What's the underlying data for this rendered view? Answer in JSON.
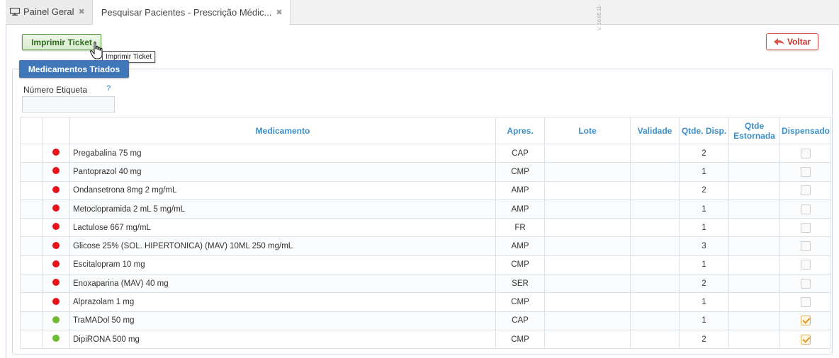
{
  "tabs": [
    {
      "label": "Painel Geral",
      "active": false
    },
    {
      "label": "Pesquisar Pacientes - Prescrição Médic...",
      "active": true
    }
  ],
  "version_text": "V. 10.85.11-",
  "print_button": {
    "label": "Imprimir Ticket",
    "tooltip": "Imprimir Ticket"
  },
  "back_button": {
    "label": "Voltar"
  },
  "panel": {
    "title": "Medicamentos Triados",
    "etiqueta_label": "Número Etiqueta",
    "etiqueta_help": "?",
    "etiqueta_value": ""
  },
  "table": {
    "columns": [
      "",
      "",
      "Medicamento",
      "Apres.",
      "Lote",
      "Validade",
      "Qtde. Disp.",
      "Qtde Estornada",
      "Dispensado"
    ],
    "status_colors": {
      "red": "#e8131a",
      "green": "#6dbb2f"
    },
    "rows": [
      {
        "status": "red",
        "medicamento": "Pregabalina 75 mg",
        "apres": "CAP",
        "lote": "",
        "validade": "",
        "qtde_disp": "2",
        "qtde_estornada": "",
        "dispensado": false
      },
      {
        "status": "red",
        "medicamento": "Pantoprazol 40 mg",
        "apres": "CMP",
        "lote": "",
        "validade": "",
        "qtde_disp": "1",
        "qtde_estornada": "",
        "dispensado": false
      },
      {
        "status": "red",
        "medicamento": "Ondansetrona 8mg 2 mg/mL",
        "apres": "AMP",
        "lote": "",
        "validade": "",
        "qtde_disp": "2",
        "qtde_estornada": "",
        "dispensado": false
      },
      {
        "status": "red",
        "medicamento": "Metoclopramida 2 mL 5 mg/mL",
        "apres": "AMP",
        "lote": "",
        "validade": "",
        "qtde_disp": "1",
        "qtde_estornada": "",
        "dispensado": false
      },
      {
        "status": "red",
        "medicamento": "Lactulose 667 mg/mL",
        "apres": "FR",
        "lote": "",
        "validade": "",
        "qtde_disp": "1",
        "qtde_estornada": "",
        "dispensado": false
      },
      {
        "status": "red",
        "medicamento": "Glicose 25% (SOL. HIPERTONICA) (MAV) 10ML 250 mg/mL",
        "apres": "AMP",
        "lote": "",
        "validade": "",
        "qtde_disp": "3",
        "qtde_estornada": "",
        "dispensado": false
      },
      {
        "status": "red",
        "medicamento": "Escitalopram 10 mg",
        "apres": "CMP",
        "lote": "",
        "validade": "",
        "qtde_disp": "1",
        "qtde_estornada": "",
        "dispensado": false
      },
      {
        "status": "red",
        "medicamento": "Enoxaparina (MAV) 40 mg",
        "apres": "SER",
        "lote": "",
        "validade": "",
        "qtde_disp": "2",
        "qtde_estornada": "",
        "dispensado": false
      },
      {
        "status": "red",
        "medicamento": "Alprazolam 1 mg",
        "apres": "CMP",
        "lote": "",
        "validade": "",
        "qtde_disp": "1",
        "qtde_estornada": "",
        "dispensado": false
      },
      {
        "status": "green",
        "medicamento": "TraMADol 50 mg",
        "apres": "CAP",
        "lote": "",
        "validade": "",
        "qtde_disp": "1",
        "qtde_estornada": "",
        "dispensado": true
      },
      {
        "status": "green",
        "medicamento": "DipiRONA 500 mg",
        "apres": "CMP",
        "lote": "",
        "validade": "",
        "qtde_disp": "2",
        "qtde_estornada": "",
        "dispensado": true
      }
    ]
  }
}
